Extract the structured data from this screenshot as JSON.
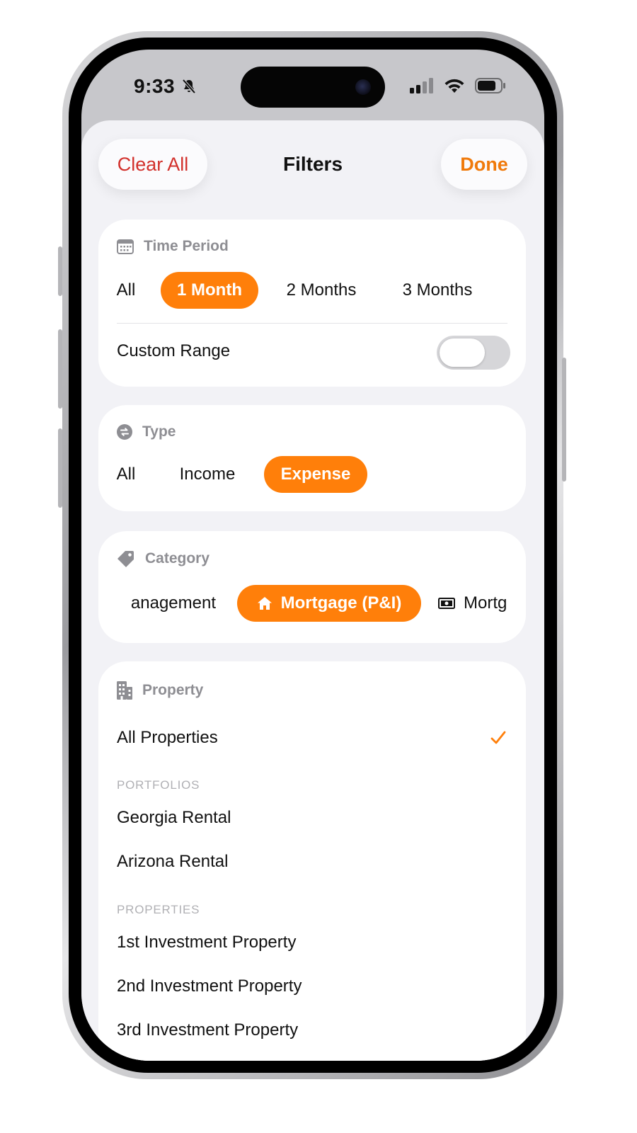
{
  "status_bar": {
    "time": "9:33"
  },
  "header": {
    "clear_label": "Clear All",
    "title": "Filters",
    "done_label": "Done"
  },
  "time_period": {
    "label": "Time Period",
    "options": [
      "All",
      "1 Month",
      "2 Months",
      "3 Months"
    ],
    "selected": "1 Month",
    "custom_range_label": "Custom Range",
    "custom_range_enabled": false
  },
  "type": {
    "label": "Type",
    "options": [
      "All",
      "Income",
      "Expense"
    ],
    "selected": "Expense"
  },
  "category": {
    "label": "Category",
    "options": [
      "anagement",
      "Mortgage (P&I)",
      "Mortg"
    ],
    "selected": "Mortgage (P&I)"
  },
  "property": {
    "label": "Property",
    "all_label": "All Properties",
    "portfolios_header": "PORTFOLIOS",
    "portfolios": [
      "Georgia Rental",
      "Arizona Rental"
    ],
    "properties_header": "PROPERTIES",
    "properties": [
      "1st Investment Property",
      "2nd Investment Property",
      "3rd Investment Property"
    ]
  },
  "colors": {
    "accent": "#ff7f0a",
    "destructive": "#d2302b"
  },
  "icons": {
    "time_period": "calendar-icon",
    "type": "swap-icon",
    "category": "tag-icon",
    "property": "building-icon",
    "mortgage_chip": "house-icon",
    "next_chip": "banknote-icon",
    "selected": "checkmark-icon"
  }
}
